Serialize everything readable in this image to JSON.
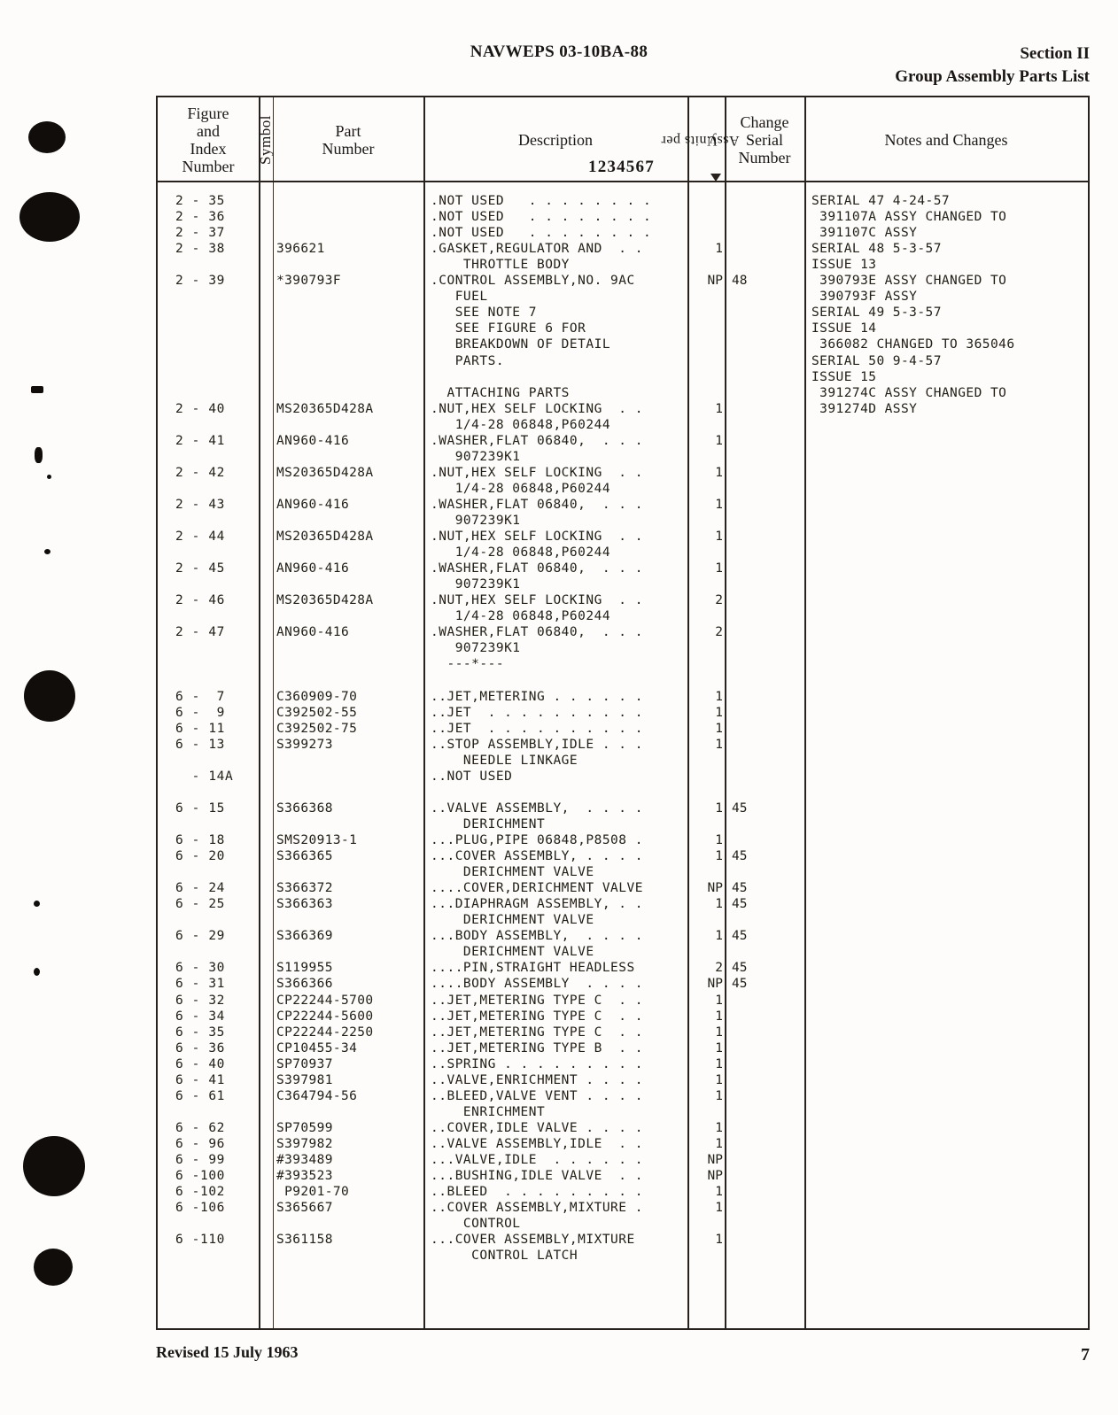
{
  "header": {
    "doc_number": "NAVWEPS 03-10BA-88",
    "section": "Section II",
    "section_sub": "Group Assembly Parts List"
  },
  "table": {
    "columns": {
      "figure_index": "Figure\nand\nIndex\nNumber",
      "figure_index_lines": [
        "Figure",
        "and",
        "Index",
        "Number"
      ],
      "symbol": "Symbol",
      "part_number_lines": [
        "Part",
        "Number"
      ],
      "description": "Description",
      "description_digits": "1234567",
      "units_per_assy_lines": [
        "Units per",
        "Assy."
      ],
      "change_serial_lines": [
        "Change",
        "Serial",
        "Number"
      ],
      "notes_and_changes": "Notes and Changes"
    },
    "rows": [
      {
        "index": "2 - 35",
        "symbol": "",
        "part": "",
        "desc": ".NOT USED   . . . . . . . .",
        "units": "",
        "change": ""
      },
      {
        "index": "2 - 36",
        "symbol": "",
        "part": "",
        "desc": ".NOT USED   . . . . . . . .",
        "units": "",
        "change": ""
      },
      {
        "index": "2 - 37",
        "symbol": "",
        "part": "",
        "desc": ".NOT USED   . . . . . . . .",
        "units": "",
        "change": ""
      },
      {
        "index": "2 - 38",
        "symbol": "",
        "part": "396621",
        "desc": ".GASKET,REGULATOR AND  . .",
        "units": "1",
        "change": ""
      },
      {
        "index": "",
        "symbol": "",
        "part": "",
        "desc": "    THROTTLE BODY",
        "units": "",
        "change": ""
      },
      {
        "index": "2 - 39",
        "symbol": "",
        "part": "*390793F",
        "desc": ".CONTROL ASSEMBLY,NO. 9AC",
        "units": "NP",
        "change": "48"
      },
      {
        "index": "",
        "symbol": "",
        "part": "",
        "desc": "   FUEL",
        "units": "",
        "change": ""
      },
      {
        "index": "",
        "symbol": "",
        "part": "",
        "desc": "   SEE NOTE 7",
        "units": "",
        "change": ""
      },
      {
        "index": "",
        "symbol": "",
        "part": "",
        "desc": "   SEE FIGURE 6 FOR",
        "units": "",
        "change": ""
      },
      {
        "index": "",
        "symbol": "",
        "part": "",
        "desc": "   BREAKDOWN OF DETAIL",
        "units": "",
        "change": ""
      },
      {
        "index": "",
        "symbol": "",
        "part": "",
        "desc": "   PARTS.",
        "units": "",
        "change": ""
      },
      {
        "index": "",
        "symbol": "",
        "part": "",
        "desc": "",
        "units": "",
        "change": ""
      },
      {
        "index": "",
        "symbol": "",
        "part": "",
        "desc": "  ATTACHING PARTS",
        "units": "",
        "change": ""
      },
      {
        "index": "2 - 40",
        "symbol": "",
        "part": "MS20365D428A",
        "desc": ".NUT,HEX SELF LOCKING  . .",
        "units": "1",
        "change": ""
      },
      {
        "index": "",
        "symbol": "",
        "part": "",
        "desc": "   1/4-28 06848,P60244",
        "units": "",
        "change": ""
      },
      {
        "index": "2 - 41",
        "symbol": "",
        "part": "AN960-416",
        "desc": ".WASHER,FLAT 06840,  . . .",
        "units": "1",
        "change": ""
      },
      {
        "index": "",
        "symbol": "",
        "part": "",
        "desc": "   907239K1",
        "units": "",
        "change": ""
      },
      {
        "index": "2 - 42",
        "symbol": "",
        "part": "MS20365D428A",
        "desc": ".NUT,HEX SELF LOCKING  . .",
        "units": "1",
        "change": ""
      },
      {
        "index": "",
        "symbol": "",
        "part": "",
        "desc": "   1/4-28 06848,P60244",
        "units": "",
        "change": ""
      },
      {
        "index": "2 - 43",
        "symbol": "",
        "part": "AN960-416",
        "desc": ".WASHER,FLAT 06840,  . . .",
        "units": "1",
        "change": ""
      },
      {
        "index": "",
        "symbol": "",
        "part": "",
        "desc": "   907239K1",
        "units": "",
        "change": ""
      },
      {
        "index": "2 - 44",
        "symbol": "",
        "part": "MS20365D428A",
        "desc": ".NUT,HEX SELF LOCKING  . .",
        "units": "1",
        "change": ""
      },
      {
        "index": "",
        "symbol": "",
        "part": "",
        "desc": "   1/4-28 06848,P60244",
        "units": "",
        "change": ""
      },
      {
        "index": "2 - 45",
        "symbol": "",
        "part": "AN960-416",
        "desc": ".WASHER,FLAT 06840,  . . .",
        "units": "1",
        "change": ""
      },
      {
        "index": "",
        "symbol": "",
        "part": "",
        "desc": "   907239K1",
        "units": "",
        "change": ""
      },
      {
        "index": "2 - 46",
        "symbol": "",
        "part": "MS20365D428A",
        "desc": ".NUT,HEX SELF LOCKING  . .",
        "units": "2",
        "change": ""
      },
      {
        "index": "",
        "symbol": "",
        "part": "",
        "desc": "   1/4-28 06848,P60244",
        "units": "",
        "change": ""
      },
      {
        "index": "2 - 47",
        "symbol": "",
        "part": "AN960-416",
        "desc": ".WASHER,FLAT 06840,  . . .",
        "units": "2",
        "change": ""
      },
      {
        "index": "",
        "symbol": "",
        "part": "",
        "desc": "   907239K1",
        "units": "",
        "change": ""
      },
      {
        "index": "",
        "symbol": "",
        "part": "",
        "desc": "  ---*---",
        "units": "",
        "change": ""
      },
      {
        "index": "",
        "symbol": "",
        "part": "",
        "desc": "",
        "units": "",
        "change": ""
      },
      {
        "index": "6 -  7",
        "symbol": "",
        "part": "C360909-70",
        "desc": "..JET,METERING . . . . . .",
        "units": "1",
        "change": ""
      },
      {
        "index": "6 -  9",
        "symbol": "",
        "part": "C392502-55",
        "desc": "..JET  . . . . . . . . . .",
        "units": "1",
        "change": ""
      },
      {
        "index": "6 - 11",
        "symbol": "",
        "part": "C392502-75",
        "desc": "..JET  . . . . . . . . . .",
        "units": "1",
        "change": ""
      },
      {
        "index": "6 - 13",
        "symbol": "",
        "part": "S399273",
        "desc": "..STOP ASSEMBLY,IDLE . . .",
        "units": "1",
        "change": ""
      },
      {
        "index": "",
        "symbol": "",
        "part": "",
        "desc": "    NEEDLE LINKAGE",
        "units": "",
        "change": ""
      },
      {
        "index": "  - 14A",
        "symbol": "",
        "part": "",
        "desc": "..NOT USED",
        "units": "",
        "change": ""
      },
      {
        "index": "",
        "symbol": "",
        "part": "",
        "desc": "",
        "units": "",
        "change": ""
      },
      {
        "index": "6 - 15",
        "symbol": "",
        "part": "S366368",
        "desc": "..VALVE ASSEMBLY,  . . . .",
        "units": "1",
        "change": "45"
      },
      {
        "index": "",
        "symbol": "",
        "part": "",
        "desc": "    DERICHMENT",
        "units": "",
        "change": ""
      },
      {
        "index": "6 - 18",
        "symbol": "",
        "part": "SMS20913-1",
        "desc": "...PLUG,PIPE 06848,P8508 .",
        "units": "1",
        "change": ""
      },
      {
        "index": "6 - 20",
        "symbol": "",
        "part": "S366365",
        "desc": "...COVER ASSEMBLY, . . . .",
        "units": "1",
        "change": "45"
      },
      {
        "index": "",
        "symbol": "",
        "part": "",
        "desc": "    DERICHMENT VALVE",
        "units": "",
        "change": ""
      },
      {
        "index": "6 - 24",
        "symbol": "",
        "part": "S366372",
        "desc": "....COVER,DERICHMENT VALVE",
        "units": "NP",
        "change": "45"
      },
      {
        "index": "6 - 25",
        "symbol": "",
        "part": "S366363",
        "desc": "...DIAPHRAGM ASSEMBLY, . .",
        "units": "1",
        "change": "45"
      },
      {
        "index": "",
        "symbol": "",
        "part": "",
        "desc": "    DERICHMENT VALVE",
        "units": "",
        "change": ""
      },
      {
        "index": "6 - 29",
        "symbol": "",
        "part": "S366369",
        "desc": "...BODY ASSEMBLY,  . . . .",
        "units": "1",
        "change": "45"
      },
      {
        "index": "",
        "symbol": "",
        "part": "",
        "desc": "    DERICHMENT VALVE",
        "units": "",
        "change": ""
      },
      {
        "index": "6 - 30",
        "symbol": "",
        "part": "S119955",
        "desc": "....PIN,STRAIGHT HEADLESS",
        "units": "2",
        "change": "45"
      },
      {
        "index": "6 - 31",
        "symbol": "",
        "part": "S366366",
        "desc": "....BODY ASSEMBLY  . . . .",
        "units": "NP",
        "change": "45"
      },
      {
        "index": "6 - 32",
        "symbol": "",
        "part": "CP22244-5700",
        "desc": "..JET,METERING TYPE C  . .",
        "units": "1",
        "change": ""
      },
      {
        "index": "6 - 34",
        "symbol": "",
        "part": "CP22244-5600",
        "desc": "..JET,METERING TYPE C  . .",
        "units": "1",
        "change": ""
      },
      {
        "index": "6 - 35",
        "symbol": "",
        "part": "CP22244-2250",
        "desc": "..JET,METERING TYPE C  . .",
        "units": "1",
        "change": ""
      },
      {
        "index": "6 - 36",
        "symbol": "",
        "part": "CP10455-34",
        "desc": "..JET,METERING TYPE B  . .",
        "units": "1",
        "change": ""
      },
      {
        "index": "6 - 40",
        "symbol": "",
        "part": "SP70937",
        "desc": "..SPRING . . . . . . . . .",
        "units": "1",
        "change": ""
      },
      {
        "index": "6 - 41",
        "symbol": "",
        "part": "S397981",
        "desc": "..VALVE,ENRICHMENT . . . .",
        "units": "1",
        "change": ""
      },
      {
        "index": "6 - 61",
        "symbol": "",
        "part": "C364794-56",
        "desc": "..BLEED,VALVE VENT . . . .",
        "units": "1",
        "change": ""
      },
      {
        "index": "",
        "symbol": "",
        "part": "",
        "desc": "    ENRICHMENT",
        "units": "",
        "change": ""
      },
      {
        "index": "6 - 62",
        "symbol": "",
        "part": "SP70599",
        "desc": "..COVER,IDLE VALVE . . . .",
        "units": "1",
        "change": ""
      },
      {
        "index": "6 - 96",
        "symbol": "",
        "part": "S397982",
        "desc": "..VALVE ASSEMBLY,IDLE  . .",
        "units": "1",
        "change": ""
      },
      {
        "index": "6 - 99",
        "symbol": "",
        "part": "#393489",
        "desc": "...VALVE,IDLE  . . . . . .",
        "units": "NP",
        "change": ""
      },
      {
        "index": "6 -100",
        "symbol": "",
        "part": "#393523",
        "desc": "...BUSHING,IDLE VALVE  . .",
        "units": "NP",
        "change": ""
      },
      {
        "index": "6 -102",
        "symbol": "",
        "part": " P9201-70",
        "desc": "..BLEED  . . . . . . . . .",
        "units": "1",
        "change": ""
      },
      {
        "index": "6 -106",
        "symbol": "",
        "part": "S365667",
        "desc": "..COVER ASSEMBLY,MIXTURE .",
        "units": "1",
        "change": ""
      },
      {
        "index": "",
        "symbol": "",
        "part": "",
        "desc": "    CONTROL",
        "units": "",
        "change": ""
      },
      {
        "index": "6 -110",
        "symbol": "",
        "part": "S361158",
        "desc": "...COVER ASSEMBLY,MIXTURE",
        "units": "1",
        "change": ""
      },
      {
        "index": "",
        "symbol": "",
        "part": "",
        "desc": "     CONTROL LATCH",
        "units": "",
        "change": ""
      }
    ],
    "notes_lines": [
      "SERIAL 47 4-24-57",
      " 391107A ASSY CHANGED TO",
      " 391107C ASSY",
      "SERIAL 48 5-3-57",
      "ISSUE 13",
      " 390793E ASSY CHANGED TO",
      " 390793F ASSY",
      "SERIAL 49 5-3-57",
      "ISSUE 14",
      " 366082 CHANGED TO 365046",
      "SERIAL 50 9-4-57",
      "ISSUE 15",
      " 391274C ASSY CHANGED TO",
      " 391274D ASSY"
    ]
  },
  "footer": {
    "revised": "Revised 15 July 1963",
    "page_number": "7"
  }
}
